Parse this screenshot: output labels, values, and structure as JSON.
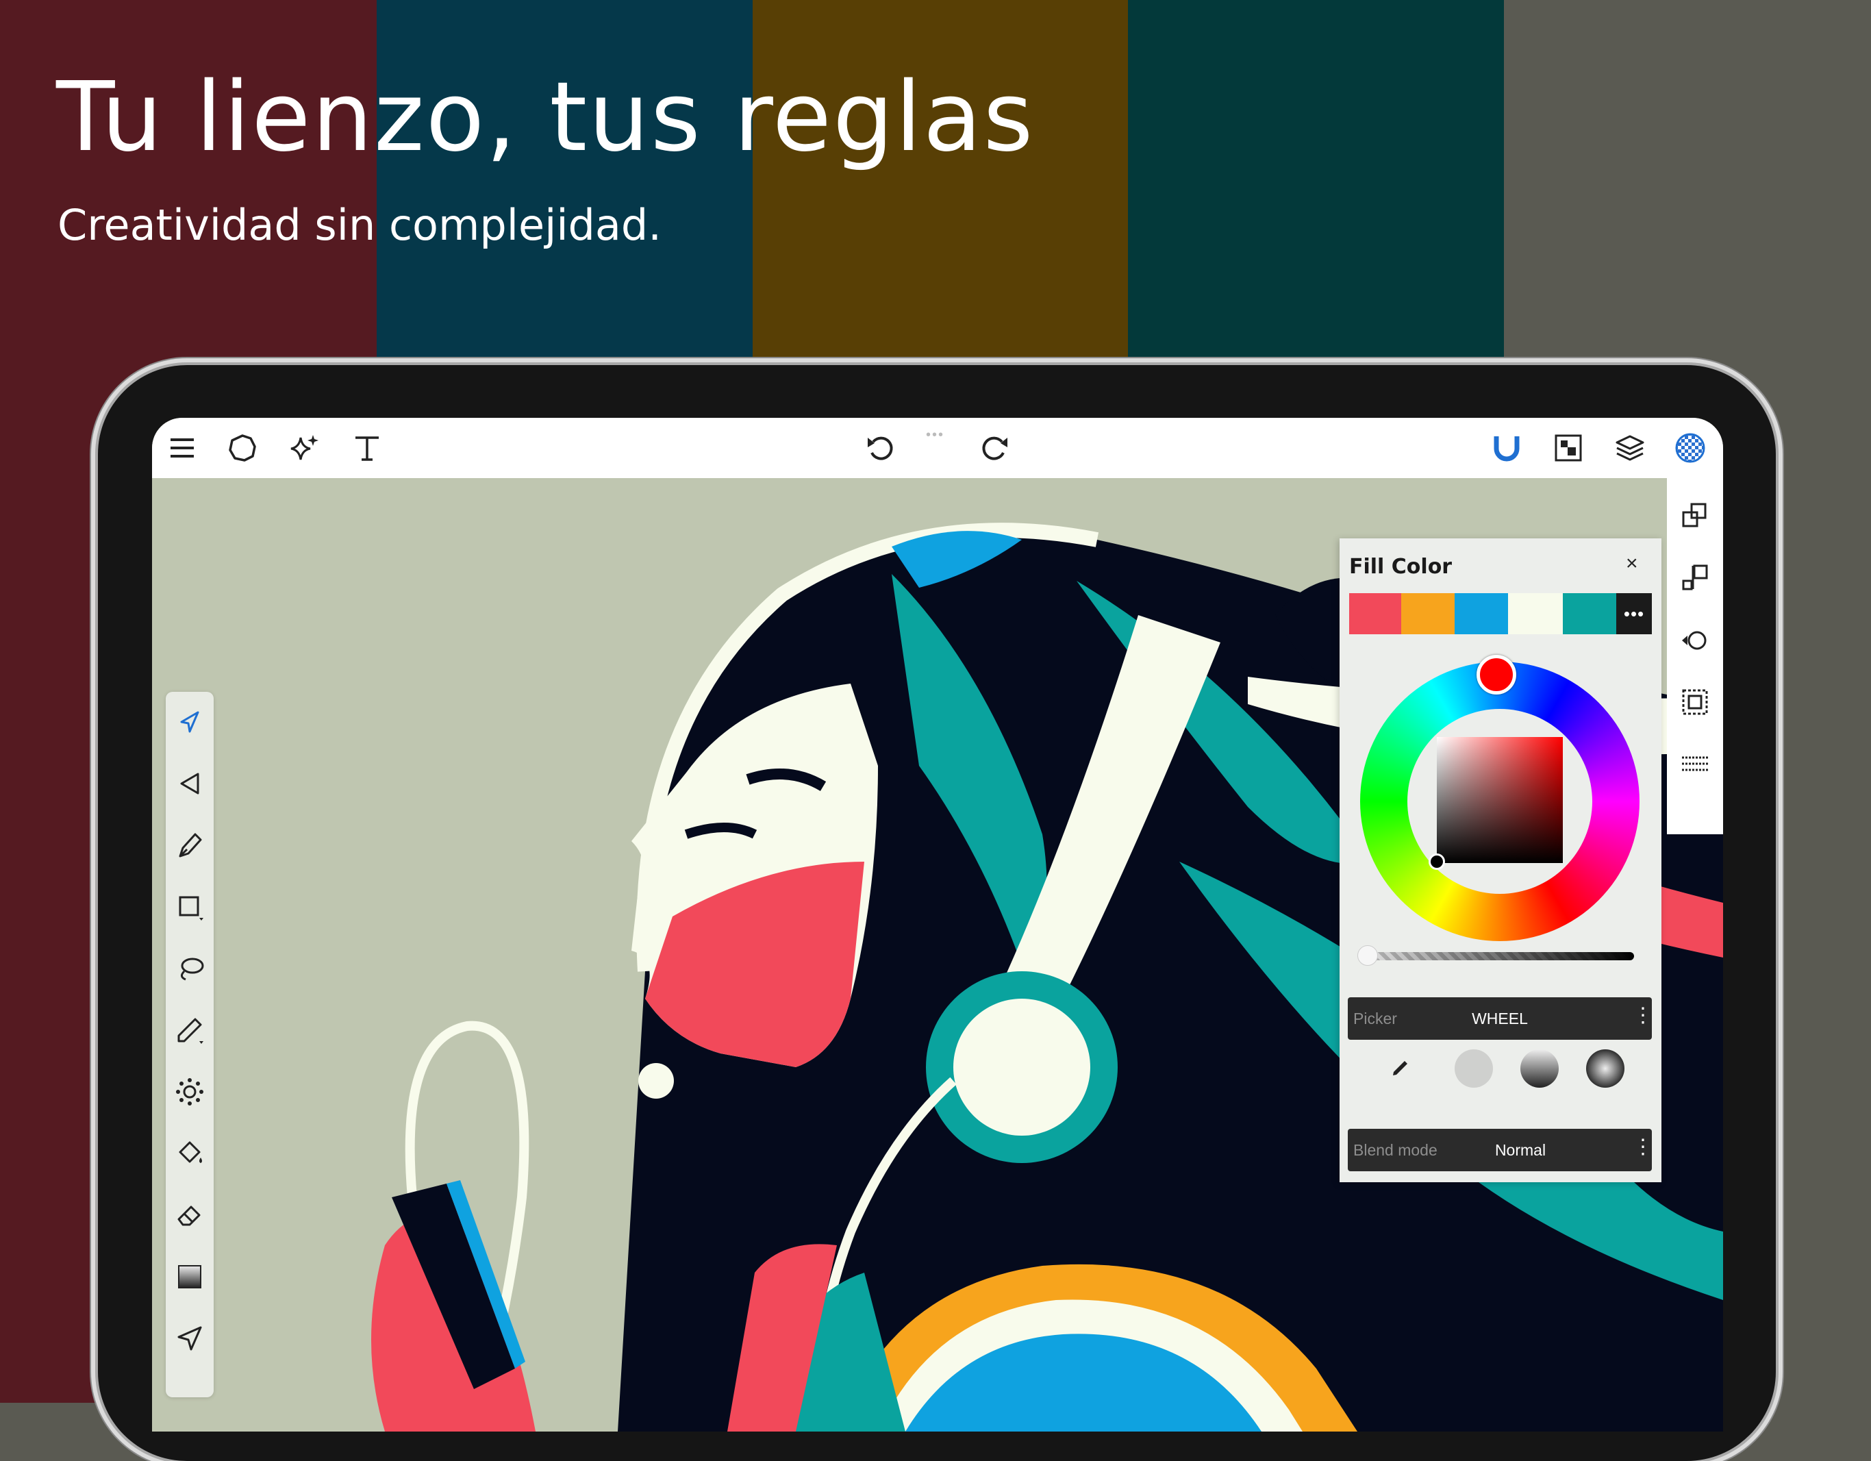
{
  "background": {
    "stripe_colors": [
      "#551a21",
      "#05384a",
      "#583f05",
      "#03393a",
      "#5a5a52"
    ]
  },
  "hero": {
    "title": "Tu lienzo, tus reglas",
    "subtitle": "Creatividad sin complejidad."
  },
  "toolbar": {
    "left_icons": [
      "menu-icon",
      "shape-icon",
      "sparkle-icon",
      "text-icon"
    ],
    "center_icons": [
      "undo-icon",
      "redo-icon"
    ],
    "right_icons": [
      "magnet-icon",
      "canvas-icon",
      "layers-icon",
      "checker-icon"
    ],
    "accent": "#1f6fd1"
  },
  "tools": [
    "select-icon",
    "direct-select-icon",
    "pen-icon",
    "rectangle-icon",
    "lasso-icon",
    "pencil-icon",
    "symmetry-icon",
    "fill-bucket-icon",
    "eraser-icon",
    "gradient-icon",
    "send-icon"
  ],
  "right_rail": [
    "arrange-icon",
    "align-icon",
    "transform-icon",
    "group-icon",
    "distribute-icon"
  ],
  "fill_panel": {
    "title": "Fill Color",
    "close": "×",
    "swatches": [
      "#f2495a",
      "#f7a41d",
      "#0fa2e0",
      "#f8fbec",
      "#0aa39e"
    ],
    "more": "•••",
    "selected_color": "#ff0000",
    "alpha": 0,
    "picker": {
      "label": "Picker",
      "value": "WHEEL",
      "menu": "⋮"
    },
    "fill_types": [
      "eyedropper-icon",
      "solid-fill",
      "linear-gradient-fill",
      "radial-gradient-fill"
    ],
    "blend": {
      "label": "Blend mode",
      "value": "Normal",
      "menu": "⋮"
    }
  }
}
